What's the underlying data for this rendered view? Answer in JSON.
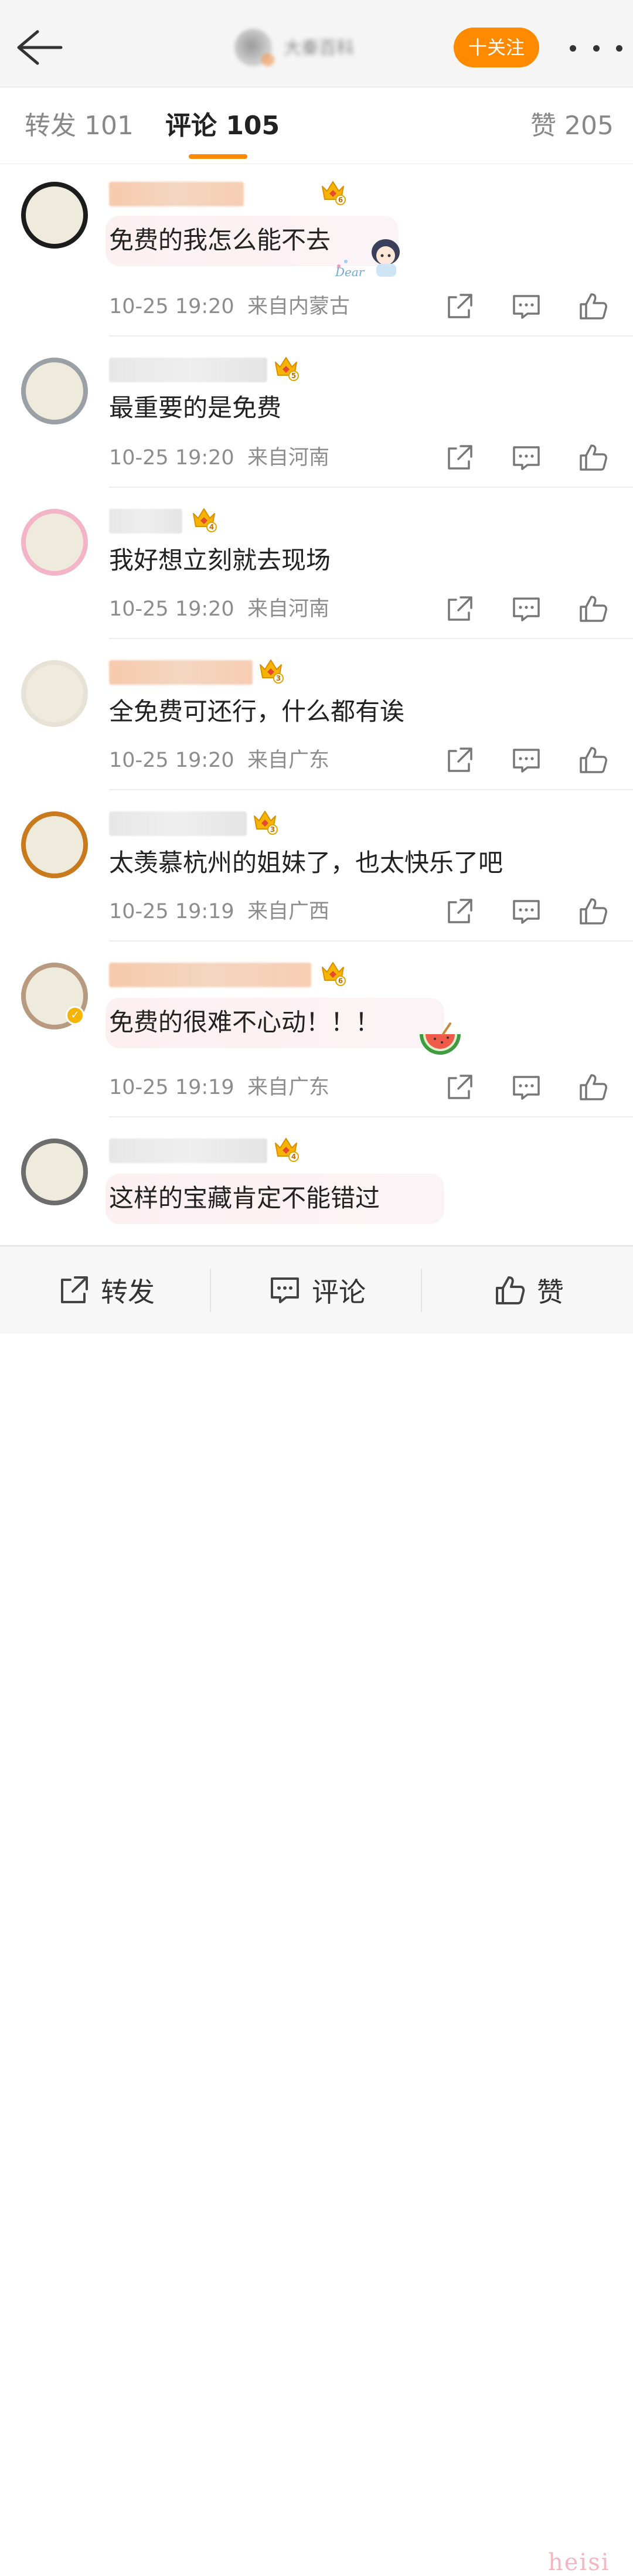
{
  "header": {
    "back_icon": "arrow-left-icon",
    "title": "大秦百科",
    "follow_label": "十关注",
    "more_icon": "more-dots-icon"
  },
  "tabs": [
    {
      "label": "转发 101",
      "active": false
    },
    {
      "label": "评论 105",
      "active": true
    },
    {
      "label": "赞 205",
      "active": false
    }
  ],
  "comments": [
    {
      "text": "免费的我怎么能不去",
      "time": "10-25 19:20",
      "location": "来自内蒙古",
      "level": "6",
      "name_color": "orange",
      "sticker_caption": "Dear"
    },
    {
      "text": "最重要的是免费",
      "time": "10-25 19:20",
      "location": "来自河南",
      "level": "5",
      "name_color": "gray"
    },
    {
      "text": "我好想立刻就去现场",
      "time": "10-25 19:20",
      "location": "来自河南",
      "level": "4",
      "name_color": "gray"
    },
    {
      "text": "全免费可还行，什么都有诶",
      "time": "10-25 19:20",
      "location": "来自广东",
      "level": "3",
      "name_color": "orange"
    },
    {
      "text": "太羡慕杭州的姐妹了，也太快乐了吧",
      "time": "10-25 19:19",
      "location": "来自广西",
      "level": "3",
      "name_color": "gray"
    },
    {
      "text": "免费的很难不心动！！！",
      "time": "10-25 19:19",
      "location": "来自广东",
      "level": "6",
      "name_color": "orange"
    },
    {
      "text": "这样的宝藏肯定不能错过",
      "level": "4",
      "name_color": "gray"
    }
  ],
  "bottom_bar": [
    {
      "label": "转发",
      "icon": "share-icon"
    },
    {
      "label": "评论",
      "icon": "comment-icon"
    },
    {
      "label": "赞",
      "icon": "like-icon"
    }
  ],
  "watermark": "heisi",
  "colors": {
    "accent": "#ff8a00",
    "meta_text": "#8d8d8d"
  }
}
